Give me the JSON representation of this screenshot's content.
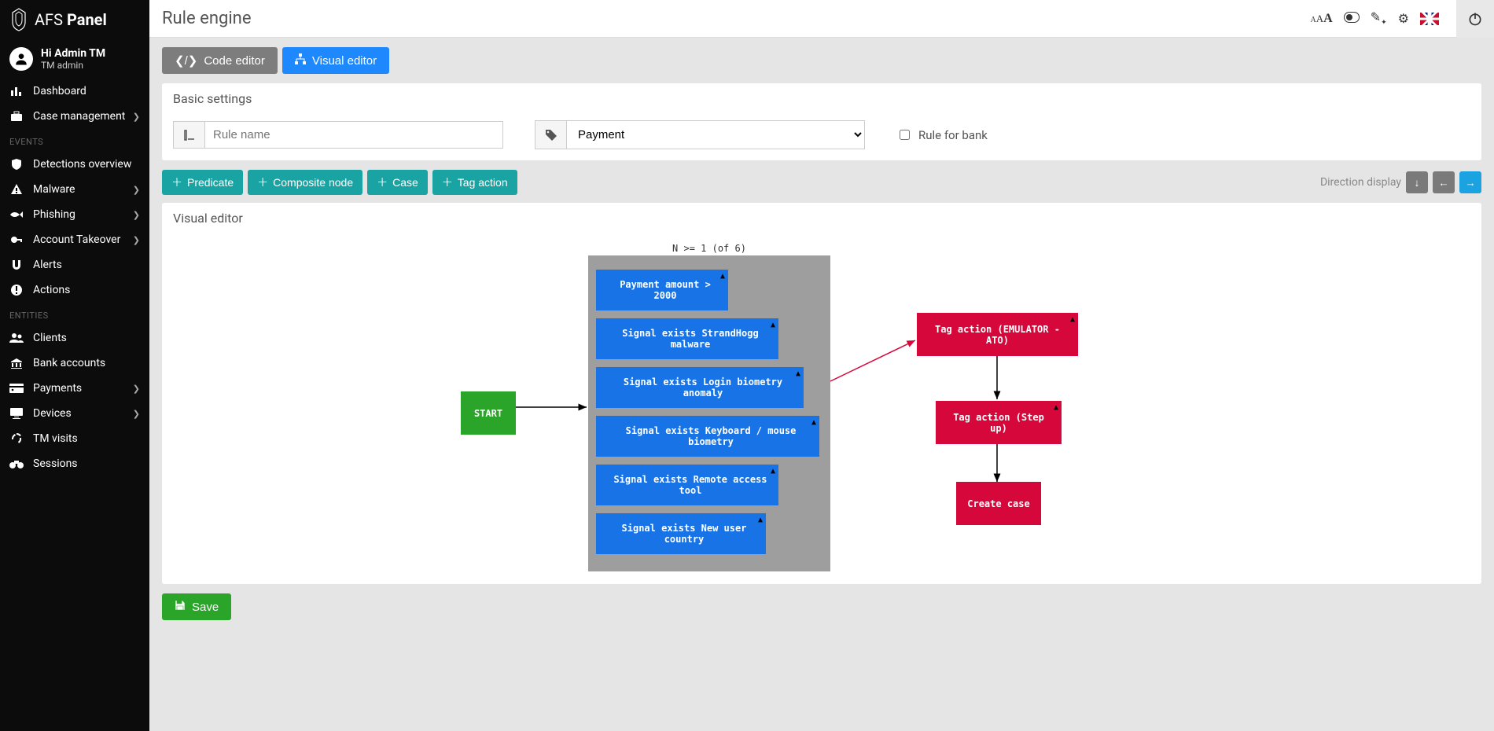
{
  "brand": {
    "pre": "AFS",
    "bold": "Panel"
  },
  "user": {
    "hi": "Hi Admin TM",
    "sub": "TM admin"
  },
  "sidebar": {
    "top": [
      {
        "icon": "chart-bar",
        "label": "Dashboard",
        "sub": false
      },
      {
        "icon": "briefcase",
        "label": "Case management",
        "sub": true
      }
    ],
    "events_hdr": "EVENTS",
    "events": [
      {
        "icon": "shield",
        "label": "Detections overview",
        "sub": false
      },
      {
        "icon": "warning",
        "label": "Malware",
        "sub": true
      },
      {
        "icon": "fish",
        "label": "Phishing",
        "sub": true
      },
      {
        "icon": "key",
        "label": "Account Takeover",
        "sub": true
      },
      {
        "icon": "magnet",
        "label": "Alerts",
        "sub": false
      },
      {
        "icon": "bang",
        "label": "Actions",
        "sub": false
      }
    ],
    "entities_hdr": "ENTITIES",
    "entities": [
      {
        "icon": "users",
        "label": "Clients",
        "sub": false
      },
      {
        "icon": "bank",
        "label": "Bank accounts",
        "sub": false
      },
      {
        "icon": "card",
        "label": "Payments",
        "sub": true
      },
      {
        "icon": "monitor",
        "label": "Devices",
        "sub": true
      },
      {
        "icon": "recycle",
        "label": "TM visits",
        "sub": false
      },
      {
        "icon": "binoc",
        "label": "Sessions",
        "sub": false
      }
    ]
  },
  "page": {
    "title": "Rule engine"
  },
  "tabs": {
    "code": "Code editor",
    "visual": "Visual editor"
  },
  "basic": {
    "hd": "Basic settings",
    "rule_name_placeholder": "Rule name",
    "rule_name_value": "",
    "type_value": "Payment",
    "bank_label": "Rule for bank"
  },
  "toolbar": {
    "predicate": "Predicate",
    "composite": "Composite node",
    "case": "Case",
    "tag": "Tag action",
    "dir_label": "Direction display"
  },
  "editor": {
    "hd": "Visual editor",
    "composite_title": "N >= 1 (of 6)",
    "start": "START",
    "predicates": [
      "Payment amount > 2000",
      "Signal exists StrandHogg malware",
      "Signal exists Login biometry anomaly",
      "Signal exists Keyboard / mouse biometry",
      "Signal exists Remote access tool",
      "Signal exists New user country"
    ],
    "actions": [
      "Tag action (EMULATOR - ATO)",
      "Tag action (Step up)",
      "Create case"
    ]
  },
  "save": "Save"
}
